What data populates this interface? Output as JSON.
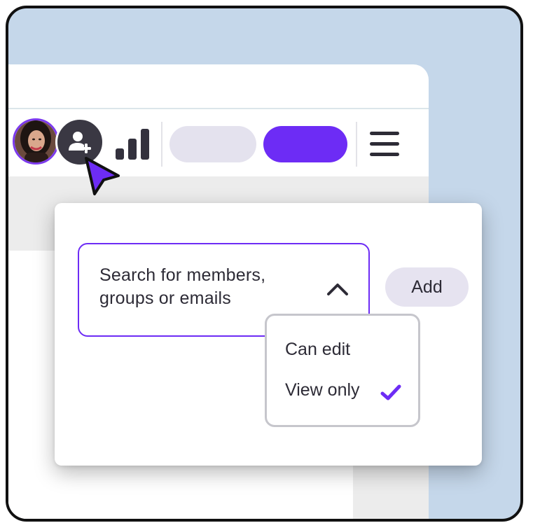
{
  "colors": {
    "accent": "#6d2cf5",
    "background": "#c5d7ea",
    "dark_button": "#3a3843",
    "pill_grey": "#e4e2ee",
    "text": "#2d2b36"
  },
  "toolbar": {
    "avatar": "user-avatar-photo",
    "add_user_icon": "add-user-icon",
    "signal_icon": "signal-bars-icon",
    "menu_icon": "hamburger-menu-icon"
  },
  "share": {
    "search_placeholder": "Search for members, groups or emails",
    "add_label": "Add",
    "permissions": [
      {
        "label": "Can edit",
        "selected": false
      },
      {
        "label": "View only",
        "selected": true
      }
    ],
    "selected_icon": "checkmark-icon",
    "dropdown_icon": "chevron-up-icon"
  }
}
